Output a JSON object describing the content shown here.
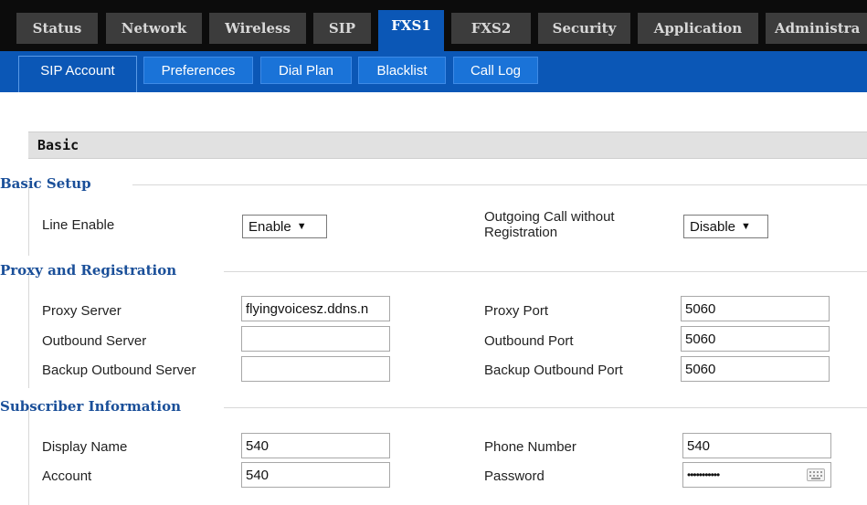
{
  "top_tabs": [
    {
      "label": "Status"
    },
    {
      "label": "Network"
    },
    {
      "label": "Wireless"
    },
    {
      "label": "SIP"
    },
    {
      "label": "FXS1",
      "active": true
    },
    {
      "label": "FXS2"
    },
    {
      "label": "Security"
    },
    {
      "label": "Application"
    },
    {
      "label": "Administra"
    }
  ],
  "sub_tabs": [
    {
      "label": "SIP Account",
      "active": true
    },
    {
      "label": "Preferences"
    },
    {
      "label": "Dial Plan"
    },
    {
      "label": "Blacklist"
    },
    {
      "label": "Call Log"
    }
  ],
  "section_title": "Basic",
  "groups": {
    "basic_setup": {
      "title": "Basic Setup",
      "line_enable_label": "Line Enable",
      "line_enable_value": "Enable",
      "outgoing_label": "Outgoing Call without Registration",
      "outgoing_value": "Disable"
    },
    "proxy": {
      "title": "Proxy and Registration",
      "proxy_server_label": "Proxy Server",
      "proxy_server_value": "flyingvoicesz.ddns.n",
      "proxy_port_label": "Proxy Port",
      "proxy_port_value": "5060",
      "outbound_server_label": "Outbound Server",
      "outbound_server_value": "",
      "outbound_port_label": "Outbound Port",
      "outbound_port_value": "5060",
      "backup_server_label": "Backup Outbound Server",
      "backup_server_value": "",
      "backup_port_label": "Backup Outbound Port",
      "backup_port_value": "5060"
    },
    "subscriber": {
      "title": "Subscriber Information",
      "display_name_label": "Display Name",
      "display_name_value": "540",
      "phone_number_label": "Phone Number",
      "phone_number_value": "540",
      "account_label": "Account",
      "account_value": "540",
      "password_label": "Password",
      "password_value": "•••••••••••"
    }
  },
  "colors": {
    "nav_bg": "#0c0c0c",
    "tab_bg": "#3c3c3c",
    "active_blue": "#0b57b6",
    "subtab_blue": "#1a73d8",
    "group_title": "#1a4f99"
  },
  "icons": {
    "select_caret": "▼",
    "keyboard": "keyboard-icon"
  }
}
